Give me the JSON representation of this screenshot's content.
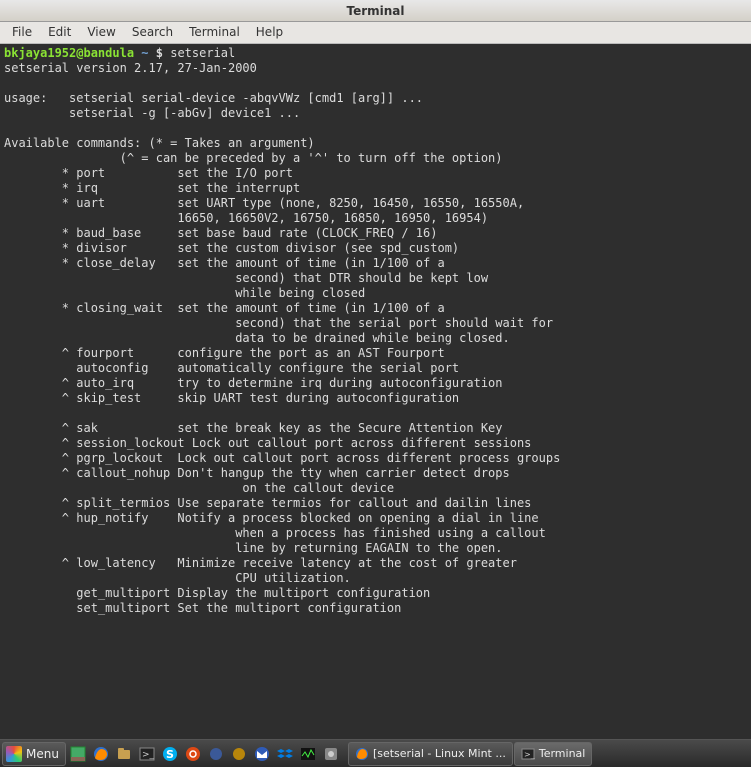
{
  "window": {
    "title": "Terminal"
  },
  "menubar": {
    "items": [
      "File",
      "Edit",
      "View",
      "Search",
      "Terminal",
      "Help"
    ]
  },
  "prompt": {
    "user_host": "bkjaya1952@bandula",
    "path": "~",
    "symbol": "$",
    "command": "setserial"
  },
  "output": {
    "lines": [
      "setserial version 2.17, 27-Jan-2000",
      "",
      "usage:   setserial serial-device -abqvVWz [cmd1 [arg]] ...",
      "         setserial -g [-abGv] device1 ...",
      "",
      "Available commands: (* = Takes an argument)",
      "                (^ = can be preceded by a '^' to turn off the option)",
      "        * port          set the I/O port",
      "        * irq           set the interrupt",
      "        * uart          set UART type (none, 8250, 16450, 16550, 16550A,",
      "                        16650, 16650V2, 16750, 16850, 16950, 16954)",
      "        * baud_base     set base baud rate (CLOCK_FREQ / 16)",
      "        * divisor       set the custom divisor (see spd_custom)",
      "        * close_delay   set the amount of time (in 1/100 of a",
      "                                second) that DTR should be kept low",
      "                                while being closed",
      "        * closing_wait  set the amount of time (in 1/100 of a",
      "                                second) that the serial port should wait for",
      "                                data to be drained while being closed.",
      "        ^ fourport      configure the port as an AST Fourport",
      "          autoconfig    automatically configure the serial port",
      "        ^ auto_irq      try to determine irq during autoconfiguration",
      "        ^ skip_test     skip UART test during autoconfiguration",
      "",
      "        ^ sak           set the break key as the Secure Attention Key",
      "        ^ session_lockout Lock out callout port across different sessions",
      "        ^ pgrp_lockout  Lock out callout port across different process groups",
      "        ^ callout_nohup Don't hangup the tty when carrier detect drops",
      "                                 on the callout device",
      "        ^ split_termios Use separate termios for callout and dailin lines",
      "        ^ hup_notify    Notify a process blocked on opening a dial in line",
      "                                when a process has finished using a callout",
      "                                line by returning EAGAIN to the open.",
      "        ^ low_latency   Minimize receive latency at the cost of greater",
      "                                CPU utilization.",
      "          get_multiport Display the multiport configuration",
      "          set_multiport Set the multiport configuration",
      ""
    ]
  },
  "taskbar": {
    "menu_label": "Menu",
    "tasks": [
      {
        "label": "[setserial - Linux Mint ...",
        "icon": "firefox"
      },
      {
        "label": "Terminal",
        "icon": "terminal",
        "active": true
      }
    ]
  }
}
